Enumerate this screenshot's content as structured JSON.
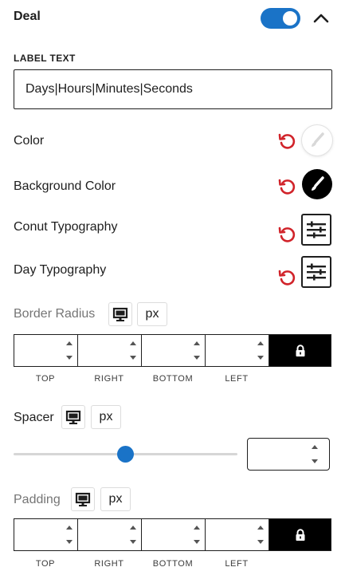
{
  "panel": {
    "title": "Deal",
    "toggle_on": true,
    "expanded": true,
    "accent_color": "#1a73c7"
  },
  "label_text": {
    "label": "LABEL TEXT",
    "value": "Days|Hours|Minutes|Seconds"
  },
  "color": {
    "label": "Color",
    "swatch_color": "#ffffff"
  },
  "background_color": {
    "label": "Background Color",
    "swatch_color": "#000000"
  },
  "count_typography": {
    "label": "Conut Typography"
  },
  "day_typography": {
    "label": "Day Typography"
  },
  "border_radius": {
    "label": "Border Radius",
    "unit": "px",
    "device": "desktop-icon",
    "sides": [
      "TOP",
      "RIGHT",
      "BOTTOM",
      "LEFT"
    ],
    "values": [
      "",
      "",
      "",
      ""
    ],
    "linked": true
  },
  "spacer": {
    "label": "Spacer",
    "unit": "px",
    "device": "desktop-icon",
    "value": ""
  },
  "padding": {
    "label": "Padding",
    "unit": "px",
    "device": "desktop-icon",
    "sides": [
      "TOP",
      "RIGHT",
      "BOTTOM",
      "LEFT"
    ],
    "values": [
      "",
      "",
      "",
      ""
    ],
    "linked": true
  },
  "reset_icon_color": "#d1232a"
}
